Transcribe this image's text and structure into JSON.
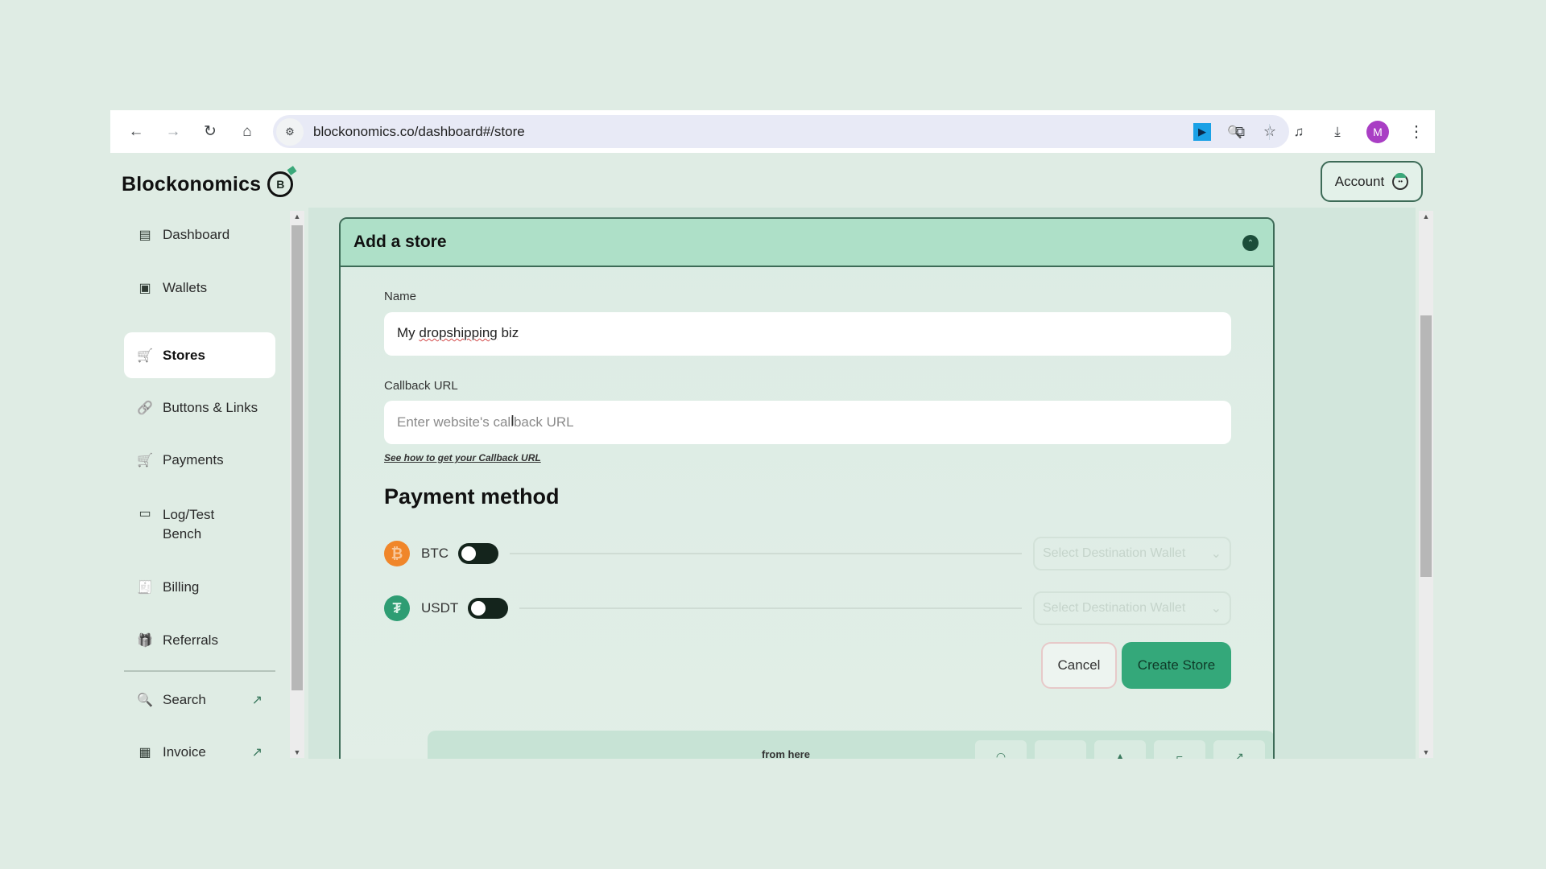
{
  "browser": {
    "url": "blockonomics.co/dashboard#/store",
    "back_icon": "←",
    "forward_icon": "→",
    "reload_icon": "↻",
    "home_icon": "⌂",
    "site_info_icon": "⚙",
    "zoom_icon": "🔍",
    "bookmark_icon": "☆",
    "extension_icon": "⧉",
    "media_icon": "♫",
    "download_icon": "⤓",
    "profile_initial": "M",
    "menu_icon": "⋮"
  },
  "app": {
    "logo_text": "Blockonomics",
    "logo_mark": "B",
    "account_label": "Account"
  },
  "sidebar": {
    "items": [
      {
        "label": "Dashboard",
        "icon": "▤"
      },
      {
        "label": "Wallets",
        "icon": "▣"
      },
      {
        "label": "Stores",
        "icon": "🛒",
        "active": true
      },
      {
        "label": "Buttons & Links",
        "icon": "🔗"
      },
      {
        "label": "Payments",
        "icon": "🛒"
      },
      {
        "label": "Log/Test Bench",
        "icon": "▭"
      },
      {
        "label": "Billing",
        "icon": "🧾"
      },
      {
        "label": "Referrals",
        "icon": "🎁"
      },
      {
        "label": "Search",
        "icon": "🔍",
        "external_icon": "↗"
      },
      {
        "label": "Invoice",
        "icon": "▦",
        "external_icon": "↗"
      }
    ]
  },
  "store_form": {
    "title": "Add a store",
    "collapse_icon": "⌃",
    "name_label": "Name",
    "name_value_prefix": "My ",
    "name_value_misspelled": "dropshipping",
    "name_value_suffix": " biz",
    "callback_label": "Callback URL",
    "callback_placeholder": "Enter website's callback URL",
    "callback_value": "",
    "callback_help_link": "See how to get your Callback URL",
    "payment_section_title": "Payment method",
    "payment_methods": [
      {
        "symbol": "₿",
        "label": "BTC",
        "enabled": false,
        "wallet_placeholder": "Select Destination Wallet"
      },
      {
        "symbol": "₮",
        "label": "USDT",
        "enabled": false,
        "wallet_placeholder": "Select Destination Wallet"
      }
    ],
    "chevron_icon": "⌄",
    "cancel_label": "Cancel",
    "create_label": "Create Store"
  },
  "bottom_strip": {
    "partial_text": "from here",
    "tile_icons": [
      "◠",
      "",
      "▲",
      "⌐",
      "↗"
    ]
  },
  "colors": {
    "accent": "#34a87a",
    "header_bg": "#aee0c8",
    "border": "#3d6b57",
    "btc": "#f0862a",
    "usdt": "#2e9d73",
    "profile": "#a93ec4"
  },
  "scroll": {
    "main_scroll_fraction": 0.2,
    "sidebar_scroll_fraction": 0.0
  }
}
